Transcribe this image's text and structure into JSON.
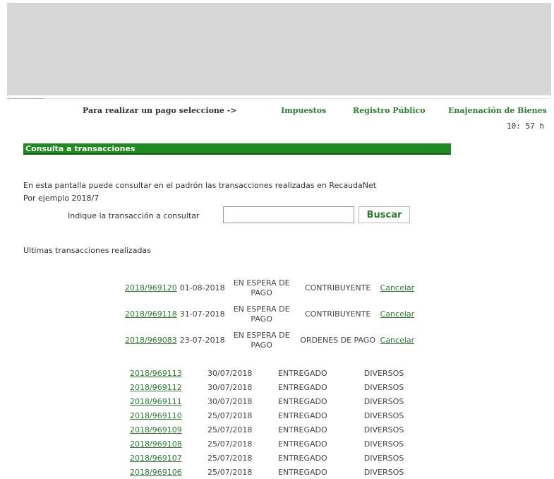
{
  "header": {
    "prompt": "Para realizar un pago seleccione ->",
    "links": [
      "Impuestos",
      "Registro Público",
      "Enajenación de Bienes"
    ],
    "clock": "10: 57 h"
  },
  "section": {
    "title": "Consulta a transacciones"
  },
  "intro": {
    "line1": "En esta pantalla puede consultar en el padrón las transacciones realizadas en RecaudaNet",
    "line2": "Por ejemplo 2018/7"
  },
  "search": {
    "label": "Indique la transacción a consultar",
    "value": "",
    "button": "Buscar"
  },
  "recent_heading": "Ultimas transacciones realizadas",
  "pending": [
    {
      "id": "2018/969120",
      "date": "01-08-2018",
      "status": "EN ESPERA DE PAGO",
      "type": "CONTRIBUYENTE",
      "action": "Cancelar"
    },
    {
      "id": "2018/969118",
      "date": "31-07-2018",
      "status": "EN ESPERA DE PAGO",
      "type": "CONTRIBUYENTE",
      "action": "Cancelar"
    },
    {
      "id": "2018/969083",
      "date": "23-07-2018",
      "status": "EN ESPERA DE PAGO",
      "type": "ORDENES DE PAGO",
      "action": "Cancelar"
    }
  ],
  "delivered": [
    {
      "id": "2018/969113",
      "date": "30/07/2018",
      "status": "ENTREGADO",
      "type": "DIVERSOS"
    },
    {
      "id": "2018/969112",
      "date": "30/07/2018",
      "status": "ENTREGADO",
      "type": "DIVERSOS"
    },
    {
      "id": "2018/969111",
      "date": "30/07/2018",
      "status": "ENTREGADO",
      "type": "DIVERSOS"
    },
    {
      "id": "2018/969110",
      "date": "25/07/2018",
      "status": "ENTREGADO",
      "type": "DIVERSOS"
    },
    {
      "id": "2018/969109",
      "date": "25/07/2018",
      "status": "ENTREGADO",
      "type": "DIVERSOS"
    },
    {
      "id": "2018/969108",
      "date": "25/07/2018",
      "status": "ENTREGADO",
      "type": "DIVERSOS"
    },
    {
      "id": "2018/969107",
      "date": "25/07/2018",
      "status": "ENTREGADO",
      "type": "DIVERSOS"
    },
    {
      "id": "2018/969106",
      "date": "25/07/2018",
      "status": "ENTREGADO",
      "type": "DIVERSOS"
    }
  ]
}
